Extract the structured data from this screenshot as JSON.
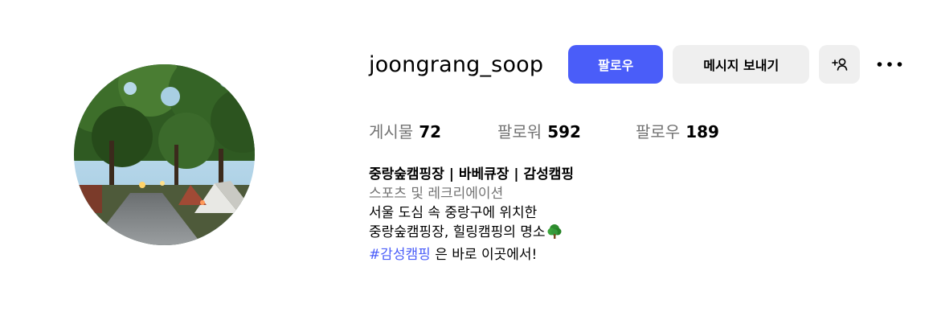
{
  "profile": {
    "username": "joongrang_soop",
    "avatar_icon": "campsite-photo"
  },
  "actions": {
    "follow_label": "팔로우",
    "message_label": "메시지 보내기",
    "add_user_icon": "add-user-icon",
    "more_icon": "more-options-icon"
  },
  "stats": {
    "posts_label": "게시물",
    "posts_value": "72",
    "followers_label": "팔로워",
    "followers_value": "592",
    "following_label": "팔로우",
    "following_value": "189"
  },
  "bio": {
    "name": "중랑숲캠핑장 | 바베큐장 | 감성캠핑",
    "category": "스포츠 및 레크리에이션",
    "line1": "서울 도심 속 중랑구에 위치한",
    "line2": "중랑숲캠핑장, 힐링캠핑의 명소",
    "line2_icon": "tree-icon",
    "hashtag": "#감성캠핑",
    "line3_rest": " 은 바로 이곳에서!"
  },
  "colors": {
    "accent": "#4a5df9",
    "secondary_button": "#efefef",
    "muted_text": "#737373"
  }
}
